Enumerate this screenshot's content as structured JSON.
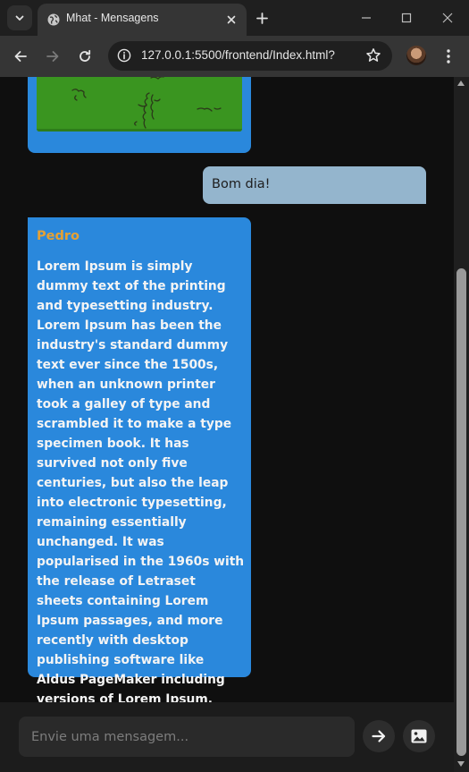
{
  "browser": {
    "tab_title": "Mhat - Mensagens",
    "url": "127.0.0.1:5500/frontend/Index.html?",
    "icons": {
      "tab_list": "chevron-down-icon",
      "favicon": "globe-icon",
      "tab_close": "close-icon",
      "new_tab": "plus-icon",
      "minimize": "minimize-icon",
      "maximize": "maximize-icon",
      "close_window": "close-icon",
      "back": "arrow-left-icon",
      "forward": "arrow-right-icon",
      "reload": "reload-icon",
      "site_info": "info-icon",
      "bookmark": "star-icon",
      "menu": "kebab-menu-icon"
    }
  },
  "chat": {
    "messages": [
      {
        "kind": "image",
        "from": "other"
      },
      {
        "kind": "text",
        "from": "me",
        "text": "Bom dia!"
      },
      {
        "kind": "text",
        "from": "other",
        "sender": "Pedro",
        "text": "Lorem Ipsum is simply dummy text of the printing and typesetting industry. Lorem Ipsum has been the industry's standard dummy text ever since the 1500s, when an unknown printer took a galley of type and scrambled it to make a type specimen book. It has survived not only five centuries, but also the leap into electronic typesetting, remaining essentially unchanged. It was popularised in the 1960s with the release of Letraset sheets containing Lorem Ipsum passages, and more recently with desktop publishing software like Aldus PageMaker including versions of Lorem Ipsum."
      }
    ],
    "colors": {
      "other_bubble": "#2a88dc",
      "my_bubble": "#94b5cd",
      "sender_name": "#e6a133",
      "background": "#0f0f0f"
    }
  },
  "composer": {
    "placeholder": "Envie uma mensagem...",
    "value": "",
    "send_icon": "arrow-right-icon",
    "image_icon": "image-icon"
  }
}
